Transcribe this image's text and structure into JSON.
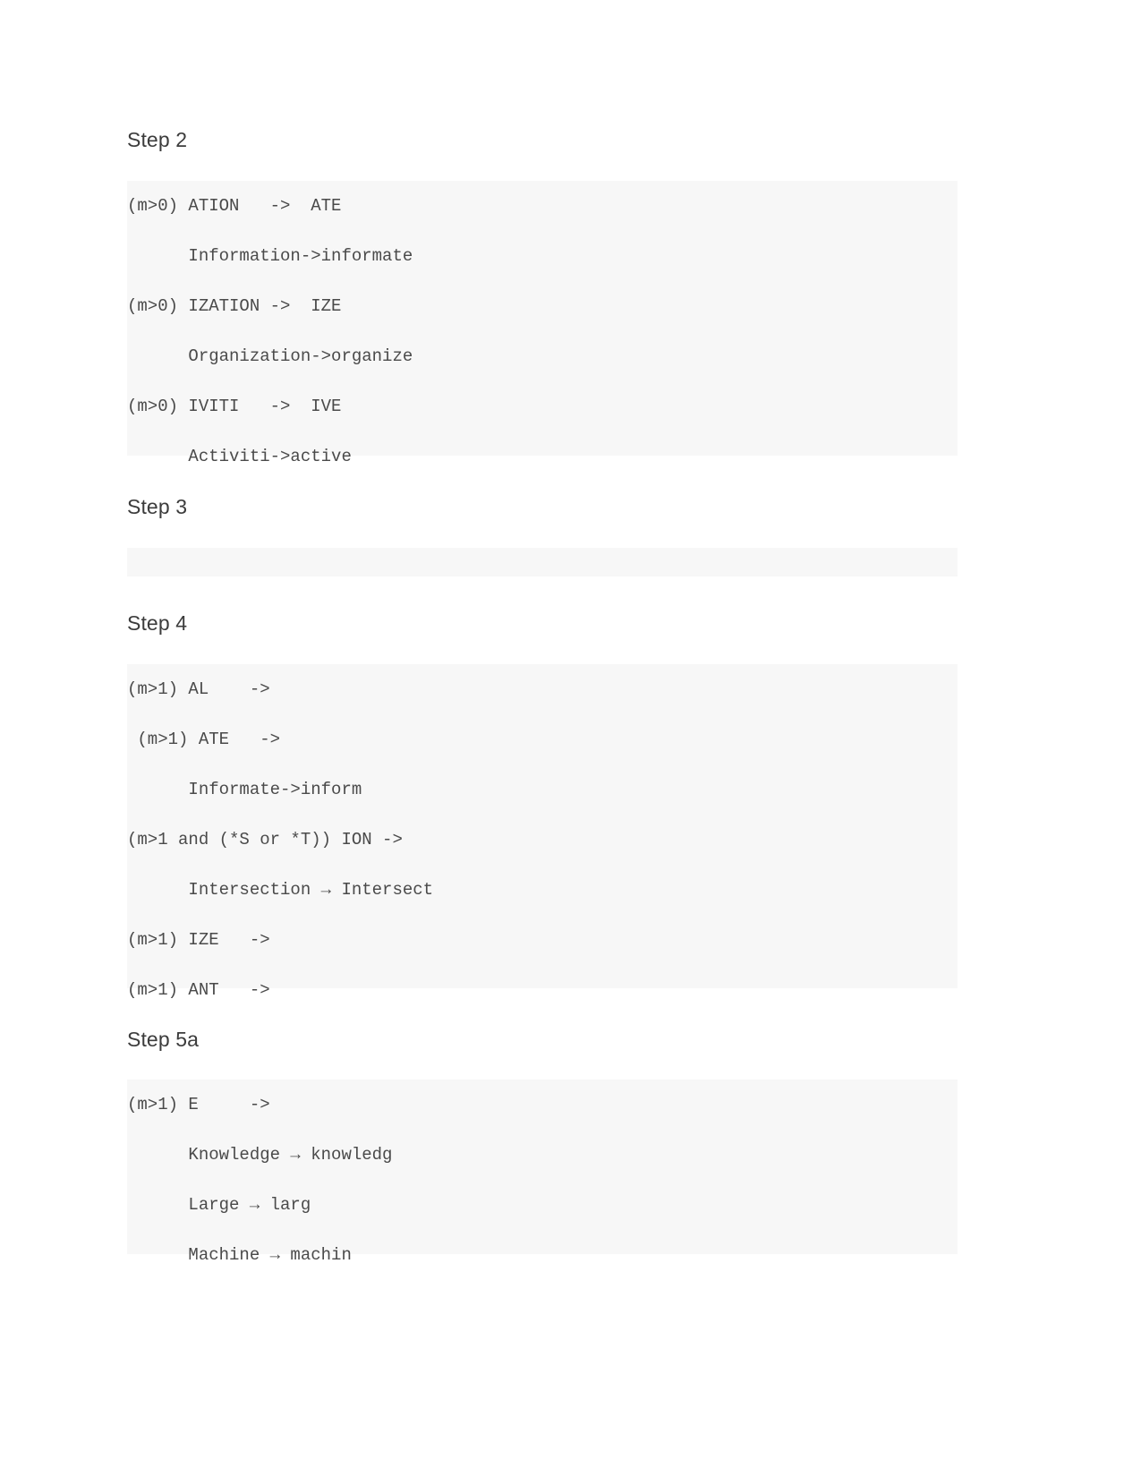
{
  "document": {
    "sections": [
      {
        "heading": "Step 2",
        "code_lines": [
          "(m>0) ATION   ->  ATE",
          "      Information->informate",
          "(m>0) IZATION ->  IZE",
          "      Organization->organize",
          "(m>0) IVITI   ->  IVE",
          "      Activiti->active"
        ]
      },
      {
        "heading": "Step 3",
        "code_lines": [
          ""
        ]
      },
      {
        "heading": "Step 4",
        "code_lines": [
          "(m>1) AL    ->",
          " (m>1) ATE   ->",
          "      Informate->inform",
          "(m>1 and (*S or *T)) ION ->",
          "      Intersection → Intersect",
          "(m>1) IZE   ->",
          "(m>1) ANT   ->"
        ]
      },
      {
        "heading": "Step 5a",
        "code_lines": [
          "(m>1) E     ->",
          "      Knowledge → knowledg",
          "      Large → larg",
          "      Machine → machin"
        ]
      }
    ]
  },
  "colors": {
    "code_background": "#f7f7f7",
    "heading_text": "#3c3c3c",
    "code_text": "#4a4a4a",
    "page_background": "#ffffff"
  }
}
